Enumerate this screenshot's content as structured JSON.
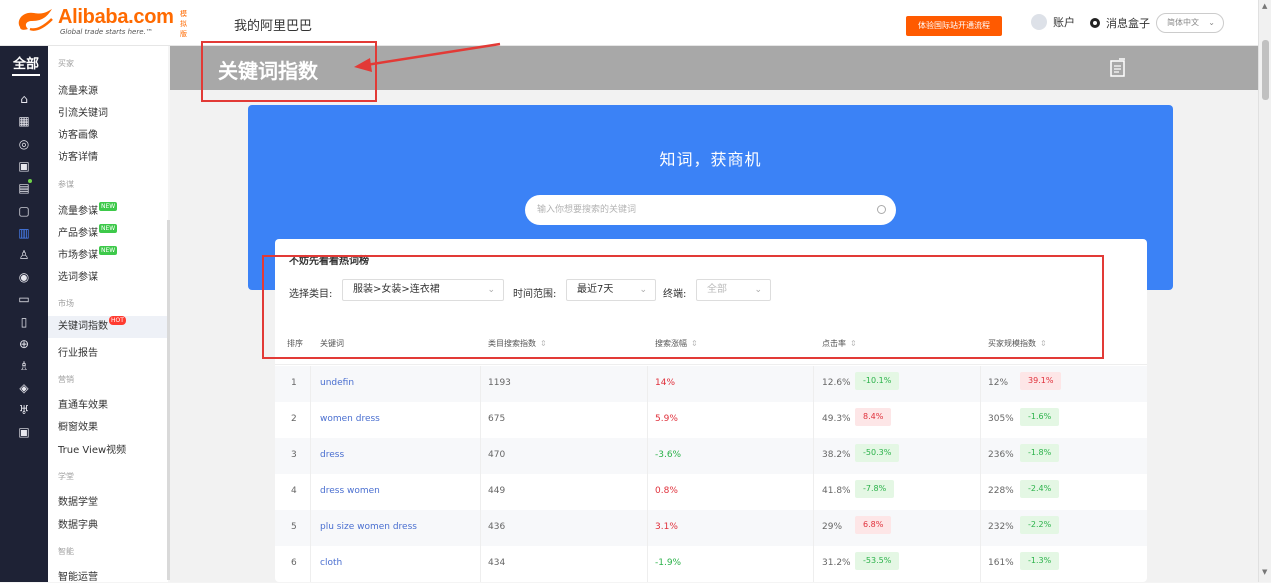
{
  "header": {
    "logo_brand": "Alibaba.com",
    "logo_beta": "模拟版",
    "logo_tagline": "Global trade starts here.™",
    "site_title": "我的阿里巴巴",
    "promo_button": "体验国际站开通流程",
    "account_label": "账户",
    "messages_label": "消息盒子",
    "language": "简体中文"
  },
  "rail": {
    "all_label": "全部"
  },
  "sidebar": {
    "sections": [
      {
        "label": "买家",
        "items": [
          {
            "label": "流量来源"
          },
          {
            "label": "引流关键词"
          },
          {
            "label": "访客画像"
          },
          {
            "label": "访客详情"
          }
        ]
      },
      {
        "label": "参谋",
        "items": [
          {
            "label": "流量参谋",
            "badge": "NEW"
          },
          {
            "label": "产品参谋",
            "badge": "NEW"
          },
          {
            "label": "市场参谋",
            "badge": "NEW"
          },
          {
            "label": "选词参谋"
          }
        ]
      },
      {
        "label": "市场",
        "items": [
          {
            "label": "关键词指数",
            "badge": "HOT"
          },
          {
            "label": "行业报告"
          }
        ]
      },
      {
        "label": "营销",
        "items": [
          {
            "label": "直通车效果"
          },
          {
            "label": "橱窗效果"
          },
          {
            "label": "True View视频"
          }
        ]
      },
      {
        "label": "学堂",
        "items": [
          {
            "label": "数据学堂"
          },
          {
            "label": "数据字典"
          }
        ]
      },
      {
        "label": "智能",
        "items": [
          {
            "label": "智能运营"
          }
        ]
      }
    ]
  },
  "page": {
    "title": "关键词指数"
  },
  "hero": {
    "title": "知词，获商机",
    "search_placeholder": "输入你想要搜索的关键词"
  },
  "hot_list": {
    "title": "不妨先看看热词榜",
    "filters": {
      "category_label": "选择类目:",
      "category_value": "服装>女装>连衣裙",
      "time_label": "时间范围:",
      "time_value": "最近7天",
      "terminal_label": "终端:",
      "terminal_value": "全部"
    },
    "columns": [
      "排序",
      "关键词",
      "类目搜索指数",
      "搜索涨幅",
      "点击率",
      "买家规模指数"
    ],
    "rows": [
      {
        "rank": "1",
        "keyword": "undefin",
        "search_index": "1193",
        "growth": "14%",
        "growth_dir": "up",
        "ctr": "12.6%",
        "ctr_change": "-10.1%",
        "ctr_dir": "down",
        "buyer_index": "12%",
        "buyer_change": "39.1%",
        "buyer_dir": "up"
      },
      {
        "rank": "2",
        "keyword": "women dress",
        "search_index": "675",
        "growth": "5.9%",
        "growth_dir": "up",
        "ctr": "49.3%",
        "ctr_change": "8.4%",
        "ctr_dir": "up",
        "buyer_index": "305%",
        "buyer_change": "-1.6%",
        "buyer_dir": "down"
      },
      {
        "rank": "3",
        "keyword": "dress",
        "search_index": "470",
        "growth": "-3.6%",
        "growth_dir": "down",
        "ctr": "38.2%",
        "ctr_change": "-50.3%",
        "ctr_dir": "down",
        "buyer_index": "236%",
        "buyer_change": "-1.8%",
        "buyer_dir": "down"
      },
      {
        "rank": "4",
        "keyword": "dress women",
        "search_index": "449",
        "growth": "0.8%",
        "growth_dir": "up",
        "ctr": "41.8%",
        "ctr_change": "-7.8%",
        "ctr_dir": "down",
        "buyer_index": "228%",
        "buyer_change": "-2.4%",
        "buyer_dir": "down"
      },
      {
        "rank": "5",
        "keyword": "plu size women dress",
        "search_index": "436",
        "growth": "3.1%",
        "growth_dir": "up",
        "ctr": "29%",
        "ctr_change": "6.8%",
        "ctr_dir": "up",
        "buyer_index": "232%",
        "buyer_change": "-2.2%",
        "buyer_dir": "down"
      },
      {
        "rank": "6",
        "keyword": "cloth",
        "search_index": "434",
        "growth": "-1.9%",
        "growth_dir": "down",
        "ctr": "31.2%",
        "ctr_change": "-53.5%",
        "ctr_dir": "down",
        "buyer_index": "161%",
        "buyer_change": "-1.3%",
        "buyer_dir": "down"
      }
    ]
  },
  "colors": {
    "accent": "#ff6a00",
    "hero_blue": "#3b82f6",
    "annotation_red": "#e23a36",
    "rail_bg": "#1e2235"
  }
}
